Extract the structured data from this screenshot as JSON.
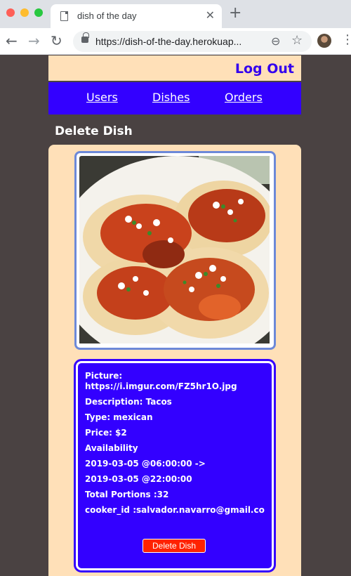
{
  "browser": {
    "tab_title": "dish of the day",
    "tab_close": "✕",
    "new_tab": "+",
    "url": "https://dish-of-the-day.herokuap..."
  },
  "header": {
    "logout_label": "Log Out"
  },
  "nav": {
    "users": "Users",
    "dishes": "Dishes",
    "orders": "Orders"
  },
  "page": {
    "title": "Delete Dish"
  },
  "dish": {
    "picture_label": "Picture:",
    "picture_url": "https://i.imgur.com/FZ5hr1O.jpg",
    "description": "Description: Tacos",
    "type": "Type: mexican",
    "price": "Price: $2",
    "availability_label": "Availability",
    "available_from": "2019-03-05 @06:00:00 ->",
    "available_to": "2019-03-05 @22:00:00",
    "total_portions": "Total Portions :32",
    "cooker": "cooker_id :salvador.navarro@gmail.co",
    "delete_label": "Delete Dish"
  },
  "colors": {
    "background": "#4a4242",
    "topbar": "#ffe0b8",
    "navbar": "#3300ff",
    "delete_button": "#ff2200"
  }
}
